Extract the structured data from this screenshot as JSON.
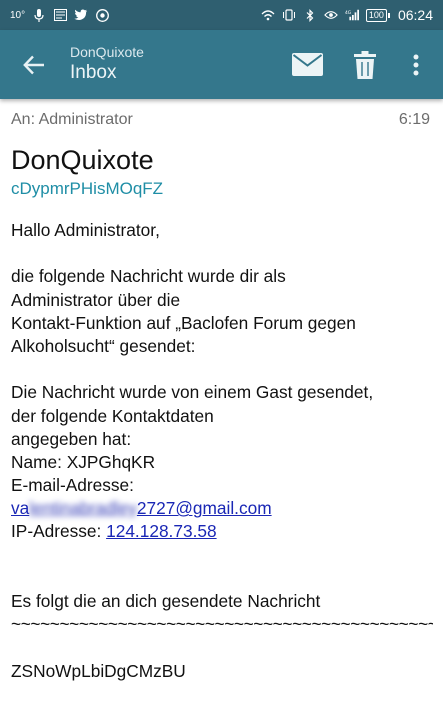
{
  "status_bar": {
    "signal_left": "10°",
    "time": "06:24",
    "battery": "100",
    "network": "4G"
  },
  "app_bar": {
    "account": "DonQuixote",
    "folder": "Inbox",
    "icons": [
      "back-arrow-icon",
      "envelope-icon",
      "trash-icon",
      "more-vert-icon"
    ]
  },
  "message": {
    "to": "An: Administrator",
    "time": "6:19",
    "subject": "DonQuixote",
    "sender": "cDypmrPHisMOqFZ",
    "greeting": "Hallo Administrator,",
    "para1": [
      "die folgende Nachricht wurde dir als",
      "Administrator über die",
      "Kontakt-Funktion auf „Baclofen Forum gegen",
      "Alkoholsucht“ gesendet:"
    ],
    "para2": [
      "Die Nachricht wurde von einem Gast gesendet,",
      "der folgende Kontaktdaten",
      "angegeben hat:"
    ],
    "name_line": "Name: XJPGhqKR",
    "email_label": "E-mail-Adresse:",
    "email_prefix": "va",
    "email_blurred": "lentinabradley",
    "email_suffix": "2727@gmail.com",
    "ip_label": "IP-Adresse: ",
    "ip_value": "124.128.73.58",
    "follow_line": "Es folgt die an dich gesendete Nachricht",
    "tilde_line": "~~~~~~~~~~~~~~~~~~~~~~~~~~~~~~~~~~~~~~~~~~~~",
    "message_body": "ZSNoWpLbiDgCMzBU"
  },
  "colors": {
    "status_bar": "#2f5f70",
    "app_bar": "#34778c",
    "sender": "#1f8ea6",
    "link": "#1a27b5"
  }
}
